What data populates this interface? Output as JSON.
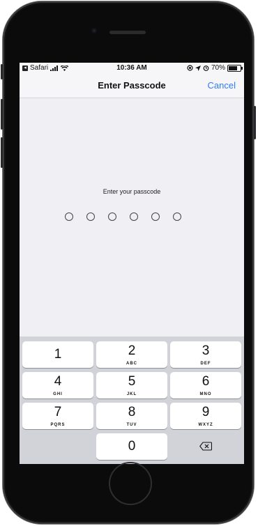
{
  "status_bar": {
    "back_app": "Safari",
    "time": "10:36 AM",
    "battery": "70%"
  },
  "nav": {
    "title": "Enter Passcode",
    "cancel_label": "Cancel"
  },
  "passcode": {
    "prompt": "Enter your passcode",
    "digits_total": 6,
    "digits_entered": 0
  },
  "keypad": [
    {
      "num": "1",
      "letters": ""
    },
    {
      "num": "2",
      "letters": "ABC"
    },
    {
      "num": "3",
      "letters": "DEF"
    },
    {
      "num": "4",
      "letters": "GHI"
    },
    {
      "num": "5",
      "letters": "JKL"
    },
    {
      "num": "6",
      "letters": "MNO"
    },
    {
      "num": "7",
      "letters": "PQRS"
    },
    {
      "num": "8",
      "letters": "TUV"
    },
    {
      "num": "9",
      "letters": "WXYZ"
    },
    {
      "num": "0",
      "letters": ""
    }
  ]
}
